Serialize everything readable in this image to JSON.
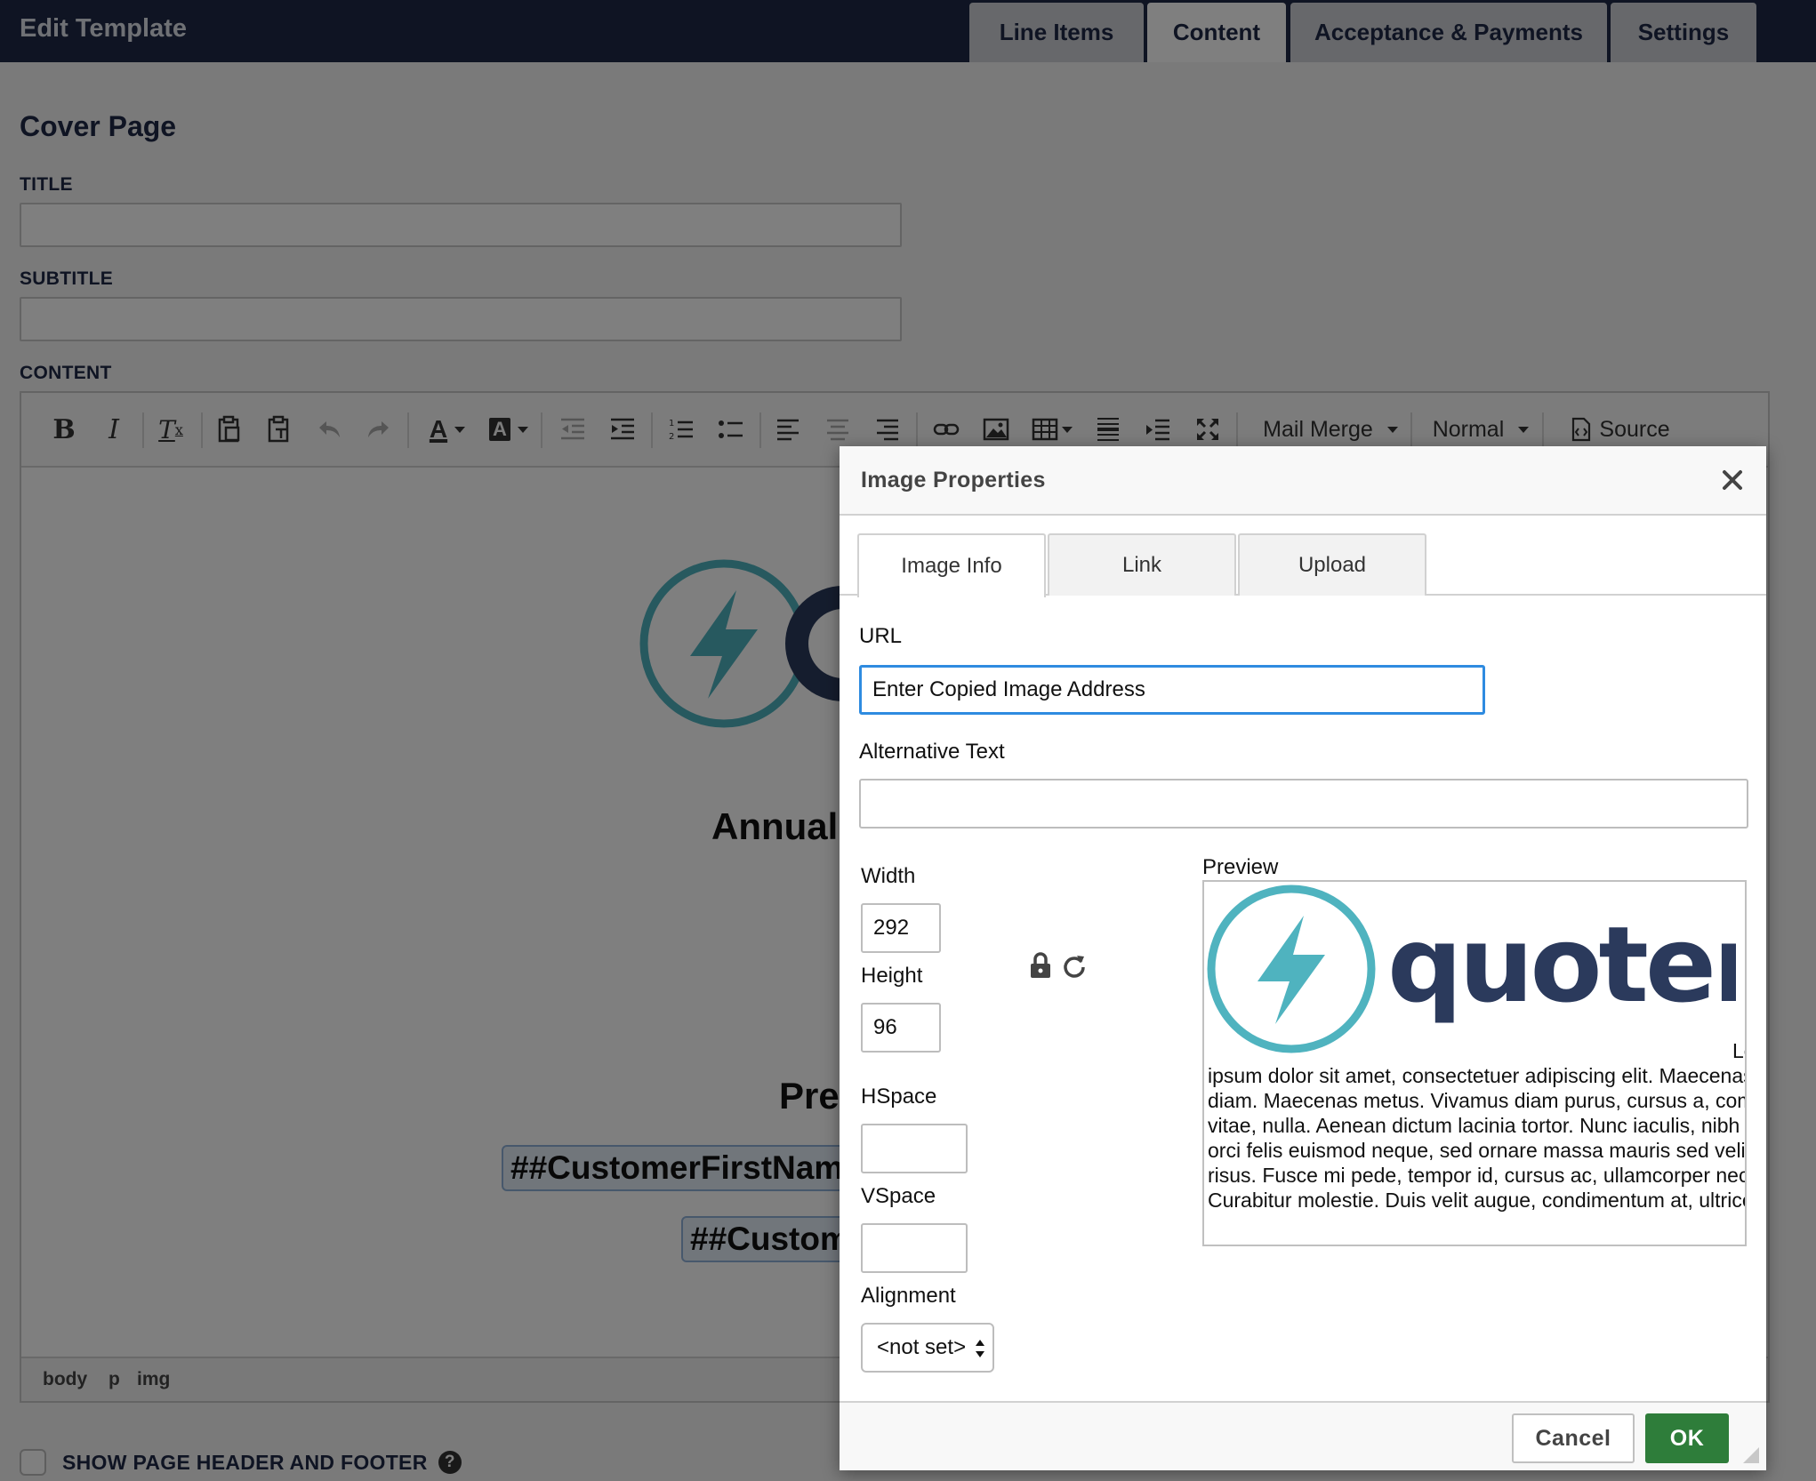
{
  "header": {
    "title": "Edit Template",
    "tabs": [
      {
        "label": "Line Items",
        "active": false
      },
      {
        "label": "Content",
        "active": true
      },
      {
        "label": "Acceptance & Payments",
        "active": false
      },
      {
        "label": "Settings",
        "active": false
      }
    ]
  },
  "cover_page": {
    "section_title": "Cover Page",
    "title_label": "TITLE",
    "title_value": "",
    "subtitle_label": "SUBTITLE",
    "subtitle_value": "",
    "content_label": "CONTENT"
  },
  "toolbar": {
    "mail_merge_label": "Mail Merge",
    "format_label": "Normal",
    "source_label": "Source"
  },
  "document": {
    "heading_1": "Annual",
    "heading_2": "Pre",
    "merge_tag_1": "##CustomerFirstName",
    "merge_tag_2": "##Custom"
  },
  "element_path": [
    "body",
    "p",
    "img"
  ],
  "footer": {
    "checkbox_label": "SHOW PAGE HEADER AND FOOTER",
    "checkbox_checked": false
  },
  "dialog": {
    "title": "Image Properties",
    "tabs": [
      {
        "label": "Image Info",
        "active": true
      },
      {
        "label": "Link",
        "active": false
      },
      {
        "label": "Upload",
        "active": false
      }
    ],
    "url_label": "URL",
    "url_value": "Enter Copied Image Address",
    "alt_label": "Alternative Text",
    "alt_value": "",
    "width_label": "Width",
    "width_value": "292",
    "height_label": "Height",
    "height_value": "96",
    "hspace_label": "HSpace",
    "hspace_value": "",
    "vspace_label": "VSpace",
    "vspace_value": "",
    "alignment_label": "Alignment",
    "alignment_value": "<not set>",
    "preview_label": "Preview",
    "preview_brand": "quoter",
    "preview_text_lead": "Lo",
    "preview_text_body": "ipsum dolor sit amet, consectetuer adipiscing elit. Maecenas feugiat consequat diam. Maecenas metus. Vivamus diam purus, cursus a, commodo non, facilisis vitae, nulla. Aenean dictum lacinia tortor. Nunc iaculis, nibh non iaculis aliquam, orci felis euismod neque, sed ornare massa mauris sed velit. Nulla pretium mi et risus. Fusce mi pede, tempor id, cursus ac, ullamcorper nec, enim. Sed tortor. Curabitur molestie. Duis velit augue, condimentum at, ultrices a, luctus ut, orci.",
    "cancel_label": "Cancel",
    "ok_label": "OK"
  },
  "colors": {
    "header_bg": "#1f2846",
    "brand_teal": "#4fb3bf",
    "brand_navy": "#2b3a5c",
    "ok_green": "#2e7d3a",
    "focus_blue": "#2e8be0"
  }
}
